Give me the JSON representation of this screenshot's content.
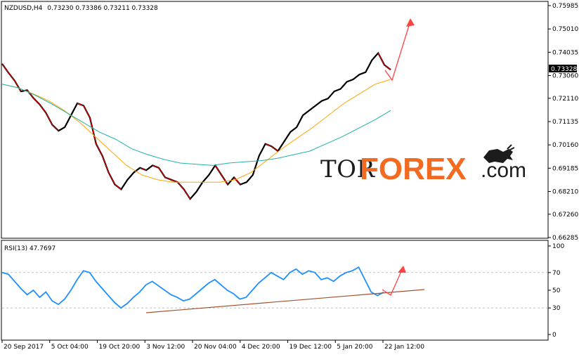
{
  "header": {
    "symbol": "NZDUSD,H4",
    "ohlc": "0.73230 0.73386 0.73211 0.73328"
  },
  "price_badge": "0.73328",
  "rsi_label": "RSI(13) 47.7697",
  "watermark": {
    "part_a": "TOR",
    "part_b": "FOREX",
    "part_c": ".com",
    "logo_icon": "bull-icon"
  },
  "colors": {
    "candle": "#000000",
    "bear_body": "#ff0000",
    "ma_fast": "#ffa500",
    "ma_slow": "#20b2aa",
    "rsi_line": "#1e90ff",
    "trendline": "#a0522d",
    "arrow": "#ff4444",
    "badge": "#000000",
    "brand": "#f26b21"
  },
  "chart_data": [
    {
      "type": "line",
      "title": "NZDUSD,H4",
      "subtitle": "0.73230 0.73386 0.73211 0.73328",
      "y_ticks": [
        "0.75985",
        "0.75010",
        "0.74035",
        "0.73060",
        "0.72110",
        "0.71135",
        "0.70160",
        "0.69185",
        "0.68210",
        "0.67260",
        "0.66285"
      ],
      "ylim": [
        0.66285,
        0.75985
      ],
      "x_ticks": [
        "20 Sep 2017",
        "5 Oct 04:00",
        "19 Oct 20:00",
        "3 Nov 12:00",
        "20 Nov 04:00",
        "4 Dec 20:00",
        "19 Dec 12:00",
        "5 Jan 20:00",
        "22 Jan 12:00"
      ],
      "grid": false,
      "series": [
        {
          "name": "",
          "values": [
            0.7355,
            0.7318,
            0.7285,
            0.724,
            0.7245,
            0.7212,
            0.7185,
            0.715,
            0.71,
            0.7075,
            0.709,
            0.714,
            0.719,
            0.718,
            0.713,
            0.702,
            0.697,
            0.69,
            0.685,
            0.683,
            0.687,
            0.69,
            0.692,
            0.691,
            0.693,
            0.692,
            0.688,
            0.687,
            0.686,
            0.683,
            0.679,
            0.682,
            0.686,
            0.689,
            0.693,
            0.689,
            0.685,
            0.688,
            0.685,
            0.686,
            0.689,
            0.697,
            0.702,
            0.701,
            0.699,
            0.703,
            0.707,
            0.709,
            0.714,
            0.716,
            0.718,
            0.72,
            0.721,
            0.724,
            0.725,
            0.728,
            0.729,
            0.731,
            0.732,
            0.737,
            0.74,
            0.735,
            0.733
          ]
        },
        {
          "name": "",
          "values": [
            0.727,
            0.7255,
            0.723,
            0.72,
            0.716,
            0.711,
            0.705,
            0.699,
            0.693,
            0.689,
            0.687,
            0.686,
            0.686,
            0.686,
            0.686,
            0.687,
            0.69,
            0.695,
            0.7,
            0.7045,
            0.709,
            0.714,
            0.719,
            0.723,
            0.727,
            0.729
          ]
        },
        {
          "name": "",
          "values": [
            0.727,
            0.7255,
            0.7225,
            0.719,
            0.715,
            0.711,
            0.707,
            0.704,
            0.7,
            0.6975,
            0.6955,
            0.694,
            0.6935,
            0.693,
            0.694,
            0.6945,
            0.695,
            0.696,
            0.6975,
            0.699,
            0.702,
            0.705,
            0.7085,
            0.712,
            0.716
          ]
        }
      ]
    },
    {
      "type": "line",
      "title": "RSI(13) 47.7697",
      "y_ticks": [
        "100",
        "70",
        "50",
        "30",
        "0"
      ],
      "ylim": [
        0,
        100
      ],
      "series": [
        {
          "name": "",
          "values": [
            70,
            68,
            60,
            52,
            45,
            50,
            42,
            48,
            38,
            34,
            40,
            50,
            62,
            72,
            70,
            60,
            52,
            44,
            36,
            30,
            35,
            42,
            48,
            56,
            60,
            55,
            50,
            45,
            42,
            38,
            40,
            46,
            52,
            58,
            62,
            56,
            50,
            46,
            40,
            42,
            50,
            58,
            64,
            70,
            66,
            62,
            70,
            74,
            68,
            72,
            70,
            62,
            64,
            60,
            66,
            70,
            72,
            76,
            62,
            48,
            44,
            47.7697
          ]
        }
      ]
    }
  ]
}
